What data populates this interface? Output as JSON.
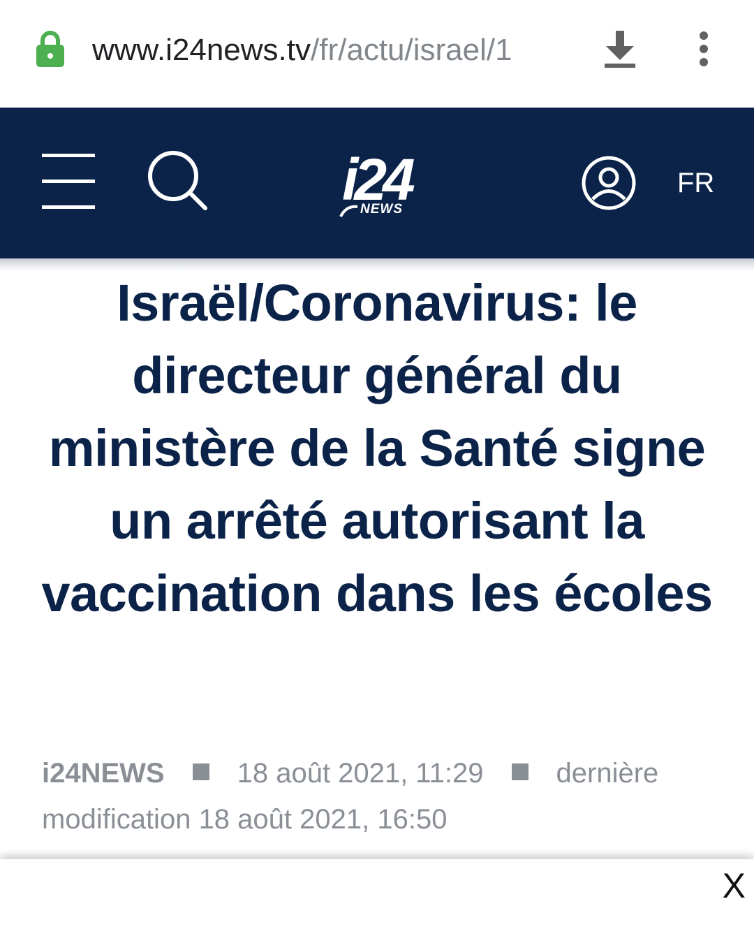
{
  "browser": {
    "url_host": "www.i24news.tv",
    "url_path": "/fr/actu/israel/1",
    "lock_color": "#4caf50"
  },
  "header": {
    "logo_main": "i24",
    "logo_sub": "NEWS",
    "language": "FR",
    "background_color": "#0c2349"
  },
  "article": {
    "title": "Israël/Coronavirus: le directeur général du ministère de la Santé signe un arrêté autorisant la vaccination dans les écoles",
    "source": "i24NEWS",
    "published": "18 août 2021, 11:29",
    "updated_label": "dernière modification",
    "updated": "18 août 2021, 16:50"
  },
  "banner": {
    "close_label": "X"
  }
}
